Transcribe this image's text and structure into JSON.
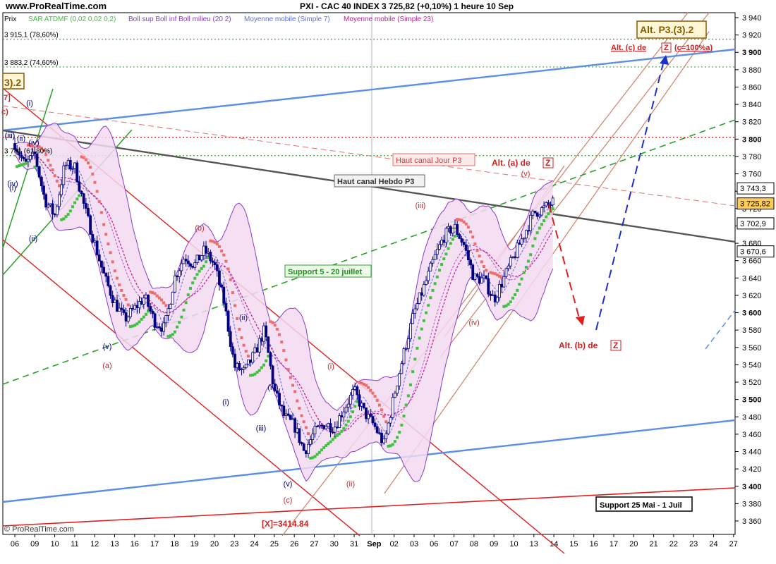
{
  "header": {
    "site": "www.ProRealTime.com",
    "title": "PXI - CAC 40 INDEX    3 725,82 (+0,10%)      1 heure  10 Sep",
    "legend_prix": "Prix",
    "legend_sar": "SAR ATDMF (0,02 0,02 0,2)",
    "legend_boll": "Boll sup Boll inf Boll milieu (20 2)",
    "legend_mm7": "Moyenne mobile (Simple 7)",
    "legend_mm23": "Moyenne mobile (Simple 23)",
    "footer": "© ProRealTime.com"
  },
  "colors": {
    "candle": "#000080",
    "boll_fill": "#f3d9f0",
    "boll_line": "#8a3cc8",
    "sar_up": "#3dc23d",
    "sar_down": "#f06b6b",
    "red": "#e02020",
    "blue": "#5b8ee8",
    "green": "#2aa02a",
    "grey": "#555555",
    "tag_label_bg": "#e8e8ff",
    "current_bg": "#ffcc55"
  },
  "chart_data": {
    "type": "candlestick",
    "title": "PXI - CAC 40 INDEX 3 725,82 (+0,10%) 1 heure 10 Sep",
    "ylim": [
      3350,
      3945
    ],
    "y_ticks": [
      3360,
      3380,
      3400,
      3420,
      3440,
      3460,
      3480,
      3500,
      3520,
      3540,
      3560,
      3580,
      3600,
      3620,
      3640,
      3660,
      3680,
      3700,
      3720,
      3740,
      3760,
      3780,
      3800,
      3820,
      3840,
      3860,
      3880,
      3900,
      3920,
      3940
    ],
    "y_tick_labels": [
      "3 360",
      "3 380",
      "3 400",
      "3 420",
      "3 440",
      "3 460",
      "3 480",
      "3 500",
      "3 520",
      "3 540",
      "3 560",
      "3 580",
      "3 600",
      "3 620",
      "3 640",
      "3 660",
      "3 680",
      "3 700",
      "3 720",
      "3 740",
      "3 760",
      "3 780",
      "3 800",
      "3 820",
      "3 840",
      "3 860",
      "3 880",
      "3 900",
      "3 920",
      "3 940"
    ],
    "x_day_labels": [
      "06",
      "09",
      "10",
      "11",
      "12",
      "13",
      "16",
      "17",
      "18",
      "19",
      "20",
      "23",
      "24",
      "25",
      "26",
      "27",
      "30",
      "31",
      "Sep",
      "02",
      "03",
      "06",
      "07",
      "08",
      "09",
      "10",
      "13",
      "14",
      "15",
      "16",
      "17",
      "20",
      "21",
      "22",
      "23",
      "24",
      "27"
    ],
    "price_path": [
      [
        0,
        3795
      ],
      [
        0.5,
        3770
      ],
      [
        1,
        3782
      ],
      [
        1.5,
        3730
      ],
      [
        2,
        3712
      ],
      [
        2.5,
        3770
      ],
      [
        3,
        3768
      ],
      [
        3.5,
        3720
      ],
      [
        4,
        3680
      ],
      [
        4.5,
        3640
      ],
      [
        5,
        3612
      ],
      [
        5.5,
        3592
      ],
      [
        6,
        3605
      ],
      [
        6.5,
        3618
      ],
      [
        7,
        3590
      ],
      [
        7.5,
        3582
      ],
      [
        8,
        3640
      ],
      [
        8.5,
        3665
      ],
      [
        9,
        3655
      ],
      [
        9.5,
        3672
      ],
      [
        10,
        3655
      ],
      [
        10.5,
        3610
      ],
      [
        11,
        3538
      ],
      [
        11.5,
        3532
      ],
      [
        12,
        3552
      ],
      [
        12.5,
        3580
      ],
      [
        13,
        3510
      ],
      [
        13.5,
        3480
      ],
      [
        14,
        3470
      ],
      [
        14.5,
        3440
      ],
      [
        15,
        3462
      ],
      [
        15.5,
        3472
      ],
      [
        16,
        3468
      ],
      [
        16.5,
        3490
      ],
      [
        17,
        3510
      ],
      [
        17.5,
        3485
      ],
      [
        18,
        3470
      ],
      [
        18.5,
        3448
      ],
      [
        19,
        3505
      ],
      [
        19.5,
        3555
      ],
      [
        20,
        3600
      ],
      [
        20.5,
        3630
      ],
      [
        21,
        3662
      ],
      [
        21.5,
        3688
      ],
      [
        22,
        3700
      ],
      [
        22.5,
        3678
      ],
      [
        23,
        3640
      ],
      [
        23.5,
        3638
      ],
      [
        24,
        3615
      ],
      [
        24.5,
        3640
      ],
      [
        25,
        3665
      ],
      [
        25.5,
        3690
      ],
      [
        26,
        3715
      ],
      [
        26.5,
        3720
      ],
      [
        27,
        3728
      ]
    ],
    "current_price": 3725.82,
    "right_labels": [
      {
        "price": 3743.3,
        "text": "3 743,3"
      },
      {
        "price": 3725.82,
        "text": "3 725,82"
      },
      {
        "price": 3702.9,
        "text": "3 702,9"
      },
      {
        "price": 3670.6,
        "text": "3 670,6"
      }
    ],
    "fib_levels": [
      {
        "price": 3915.1,
        "text": "3 915,1 (78,60%)"
      },
      {
        "price": 3883.2,
        "text": "3 883,2 (74,60%)"
      },
      {
        "price": 3802,
        "text": ""
      },
      {
        "price": 3781,
        "text": "3 781 (61,80%)"
      }
    ],
    "annotations": {
      "alt_p3": "Alt. P3.(3).2",
      "alt_c": "Alt. (c) de",
      "alt_c_box": "Z",
      "alt_c_tail": "(c=100%a)",
      "alt_a": "Alt. (a) de",
      "alt_a_box": "Z",
      "alt_b": "Alt. (b) de",
      "alt_b_box": "Z",
      "haut_jour": "Haut canal Jour P3",
      "haut_hebdo": "Haut canal Hebdo P3",
      "support5": "Support 5 - 20 juillet",
      "support25": "Support 25 Mai - 1 Juil",
      "x_label": "[X]=3414.84",
      "left_tag": "3).2",
      "left_tag_b": "7]",
      "left_tag_c": "c)"
    },
    "waves": [
      {
        "t": "(iii)",
        "c": "#000080"
      },
      {
        "t": "(iv)",
        "c": "#000080"
      },
      {
        "t": "(ii)",
        "c": "#000080"
      },
      {
        "t": "(i)",
        "c": "#000080"
      },
      {
        "t": "(v)",
        "c": "#000080"
      },
      {
        "t": "(a)",
        "c": "#c03030"
      },
      {
        "t": "(b)",
        "c": "#c03030"
      },
      {
        "t": "(ii)",
        "c": "#000080"
      },
      {
        "t": "(i)",
        "c": "#000080"
      },
      {
        "t": "(iv)",
        "c": "#000080"
      },
      {
        "t": "(iii)",
        "c": "#000080"
      },
      {
        "t": "(v)",
        "c": "#000080"
      },
      {
        "t": "(c)",
        "c": "#c03030"
      },
      {
        "t": "(i)",
        "c": "#c03030"
      },
      {
        "t": "(ii)",
        "c": "#c03030"
      },
      {
        "t": "(iii)",
        "c": "#c03030"
      },
      {
        "t": "(iv)",
        "c": "#c03030"
      },
      {
        "t": "(v)",
        "c": "#c03030"
      },
      {
        "t": "(i)",
        "c": "#000080"
      },
      {
        "t": "(iii)",
        "c": "#000080"
      },
      {
        "t": "(iv)",
        "c": "#000080"
      },
      {
        "t": "(ii)",
        "c": "#000080"
      }
    ]
  }
}
